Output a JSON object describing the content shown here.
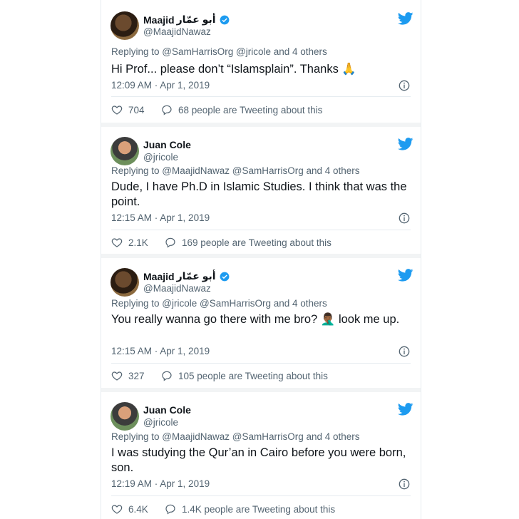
{
  "tweets": [
    {
      "name": "Maajid",
      "name_arabic": "أبو عمّار",
      "handle": "@MaajidNawaz",
      "verified": true,
      "replying": "Replying to @SamHarrisOrg @jricole and 4 others",
      "text": "Hi Prof... please don’t “Islamsplain”. Thanks 🙏",
      "time": "12:09 AM · Apr 1, 2019",
      "likes": "704",
      "tweeting": "68 people are Tweeting about this"
    },
    {
      "name": "Juan Cole",
      "handle": "@jricole",
      "verified": false,
      "replying": "Replying to @MaajidNawaz @SamHarrisOrg and 4 others",
      "text": "Dude, I have  Ph.D in Islamic Studies.  I think that was the point.",
      "time": "12:15 AM · Apr 1, 2019",
      "likes": "2.1K",
      "tweeting": "169 people are Tweeting about this"
    },
    {
      "name": "Maajid",
      "name_arabic": "أبو عمّار",
      "handle": "@MaajidNawaz",
      "verified": true,
      "replying": "Replying to @jricole @SamHarrisOrg and 4 others",
      "text": "You really wanna go there with me bro? 🤦🏾‍♂️ look me up.",
      "time": "12:15 AM · Apr 1, 2019",
      "likes": "327",
      "tweeting": "105 people are Tweeting about this"
    },
    {
      "name": "Juan Cole",
      "handle": "@jricole",
      "verified": false,
      "replying": "Replying to @MaajidNawaz @SamHarrisOrg and 4 others",
      "text": "I was studying the Qur’an in Cairo before you were born, son.",
      "time": "12:19 AM · Apr 1, 2019",
      "likes": "6.4K",
      "tweeting": "1.4K people are Tweeting about this"
    }
  ],
  "icons": {
    "brand": "twitter-bird-icon",
    "verified": "verified-badge-icon",
    "info": "info-icon",
    "like": "heart-icon",
    "reply": "speech-bubble-icon"
  },
  "colors": {
    "brand": "#1d9bf0",
    "text": "#0f1419",
    "muted": "#536471",
    "border": "#e6ecf0"
  }
}
